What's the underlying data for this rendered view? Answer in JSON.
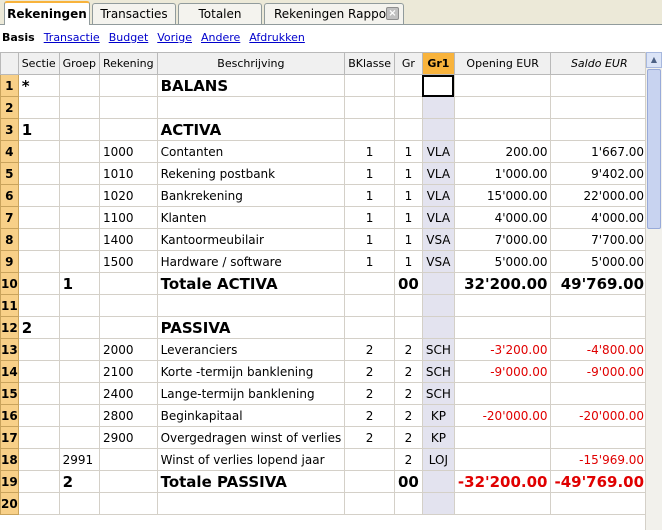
{
  "tabs": [
    {
      "label": "Rekeningen",
      "active": true
    },
    {
      "label": "Transacties"
    },
    {
      "label": "Totalen"
    },
    {
      "label": "Rekeningen Rapport",
      "closable": true
    }
  ],
  "views": {
    "current": "Basis",
    "links": [
      "Transactie",
      "Budget",
      "Vorige",
      "Andere",
      "Afdrukken"
    ]
  },
  "columns": [
    "Sectie",
    "Groep",
    "Rekening",
    "Beschrijving",
    "BKlasse",
    "Gr",
    "Gr1",
    "Opening EUR",
    "Saldo EUR"
  ],
  "rows": [
    {
      "n": "1",
      "sectie": "*",
      "groep": "",
      "rek": "",
      "besch": "BALANS",
      "bk": "",
      "gr": "",
      "gr1": "",
      "open": "",
      "saldo": "",
      "type": "title"
    },
    {
      "n": "2",
      "sectie": "",
      "groep": "",
      "rek": "",
      "besch": "",
      "bk": "",
      "gr": "",
      "gr1": "",
      "open": "",
      "saldo": "",
      "type": "empty"
    },
    {
      "n": "3",
      "sectie": "1",
      "groep": "",
      "rek": "",
      "besch": "ACTIVA",
      "bk": "",
      "gr": "",
      "gr1": "",
      "open": "",
      "saldo": "",
      "type": "title"
    },
    {
      "n": "4",
      "sectie": "",
      "groep": "",
      "rek": "1000",
      "besch": "Contanten",
      "bk": "1",
      "gr": "1",
      "gr1": "VLA",
      "open": "200.00",
      "saldo": "1'667.00"
    },
    {
      "n": "5",
      "sectie": "",
      "groep": "",
      "rek": "1010",
      "besch": "Rekening postbank",
      "bk": "1",
      "gr": "1",
      "gr1": "VLA",
      "open": "1'000.00",
      "saldo": "9'402.00"
    },
    {
      "n": "6",
      "sectie": "",
      "groep": "",
      "rek": "1020",
      "besch": "Bankrekening",
      "bk": "1",
      "gr": "1",
      "gr1": "VLA",
      "open": "15'000.00",
      "saldo": "22'000.00"
    },
    {
      "n": "7",
      "sectie": "",
      "groep": "",
      "rek": "1100",
      "besch": "Klanten",
      "bk": "1",
      "gr": "1",
      "gr1": "VLA",
      "open": "4'000.00",
      "saldo": "4'000.00"
    },
    {
      "n": "8",
      "sectie": "",
      "groep": "",
      "rek": "1400",
      "besch": "Kantoormeubilair",
      "bk": "1",
      "gr": "1",
      "gr1": "VSA",
      "open": "7'000.00",
      "saldo": "7'700.00"
    },
    {
      "n": "9",
      "sectie": "",
      "groep": "",
      "rek": "1500",
      "besch": "Hardware / software",
      "bk": "1",
      "gr": "1",
      "gr1": "VSA",
      "open": "5'000.00",
      "saldo": "5'000.00"
    },
    {
      "n": "10",
      "sectie": "",
      "groep": "1",
      "rek": "",
      "besch": "Totale ACTIVA",
      "bk": "",
      "gr": "00",
      "gr1": "",
      "open": "32'200.00",
      "saldo": "49'769.00",
      "type": "total"
    },
    {
      "n": "11",
      "sectie": "",
      "groep": "",
      "rek": "",
      "besch": "",
      "bk": "",
      "gr": "",
      "gr1": "",
      "open": "",
      "saldo": "",
      "type": "empty"
    },
    {
      "n": "12",
      "sectie": "2",
      "groep": "",
      "rek": "",
      "besch": "PASSIVA",
      "bk": "",
      "gr": "",
      "gr1": "",
      "open": "",
      "saldo": "",
      "type": "title"
    },
    {
      "n": "13",
      "sectie": "",
      "groep": "",
      "rek": "2000",
      "besch": "Leveranciers",
      "bk": "2",
      "gr": "2",
      "gr1": "SCH",
      "open": "-3'200.00",
      "saldo": "-4'800.00",
      "neg": true
    },
    {
      "n": "14",
      "sectie": "",
      "groep": "",
      "rek": "2100",
      "besch": "Korte -termijn banklening",
      "bk": "2",
      "gr": "2",
      "gr1": "SCH",
      "open": "-9'000.00",
      "saldo": "-9'000.00",
      "neg": true
    },
    {
      "n": "15",
      "sectie": "",
      "groep": "",
      "rek": "2400",
      "besch": "Lange-termijn banklening",
      "bk": "2",
      "gr": "2",
      "gr1": "SCH",
      "open": "",
      "saldo": "",
      "neg": true
    },
    {
      "n": "16",
      "sectie": "",
      "groep": "",
      "rek": "2800",
      "besch": "Beginkapitaal",
      "bk": "2",
      "gr": "2",
      "gr1": "KP",
      "open": "-20'000.00",
      "saldo": "-20'000.00",
      "neg": true
    },
    {
      "n": "17",
      "sectie": "",
      "groep": "",
      "rek": "2900",
      "besch": "Overgedragen winst of verlies",
      "bk": "2",
      "gr": "2",
      "gr1": "KP",
      "open": "",
      "saldo": "",
      "neg": true
    },
    {
      "n": "18",
      "sectie": "",
      "groep": "2991",
      "rek": "",
      "besch": "Winst of verlies lopend jaar",
      "bk": "",
      "gr": "2",
      "gr1": "LOJ",
      "open": "",
      "saldo": "-15'969.00",
      "neg": true
    },
    {
      "n": "19",
      "sectie": "",
      "groep": "2",
      "rek": "",
      "besch": "Totale PASSIVA",
      "bk": "",
      "gr": "00",
      "gr1": "",
      "open": "-32'200.00",
      "saldo": "-49'769.00",
      "type": "total",
      "neg": true
    },
    {
      "n": "20",
      "sectie": "",
      "groep": "",
      "rek": "",
      "besch": "",
      "bk": "",
      "gr": "",
      "gr1": "",
      "open": "",
      "saldo": "",
      "type": "empty"
    }
  ],
  "colors": {
    "accent": "#f8b33c",
    "rownum_bg": "#f8d088",
    "negative": "#e00000",
    "gr1_bg": "#e3e3ef"
  }
}
